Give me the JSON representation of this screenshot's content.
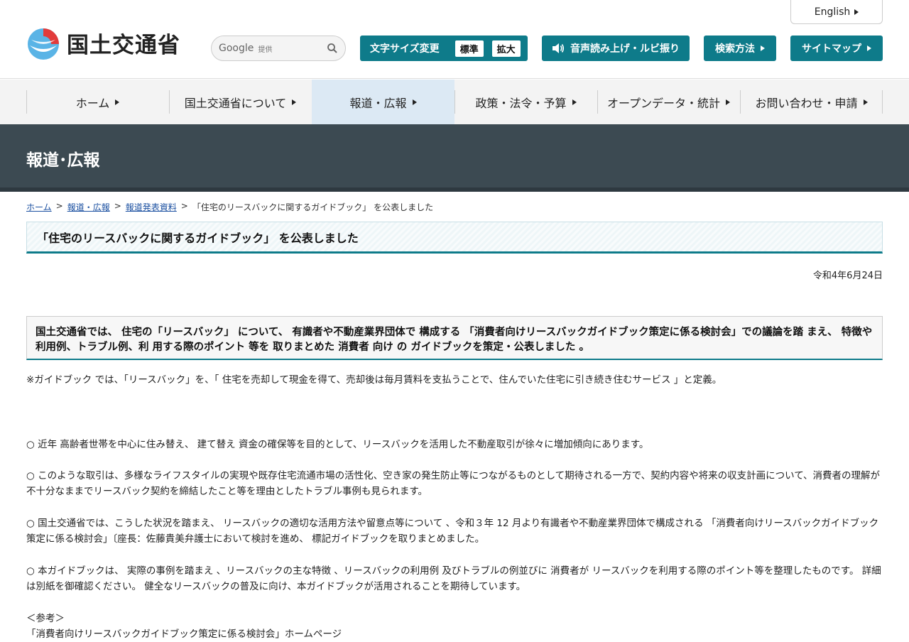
{
  "header": {
    "logo_text": "国土交通省",
    "english_label": "English",
    "search": {
      "brand": "Google",
      "provided": "提供",
      "placeholder": ""
    },
    "fontsize": {
      "label": "文字サイズ変更",
      "standard": "標準",
      "large": "拡大"
    },
    "voice_label": "音声読み上げ・ルビ振り",
    "howto_label": "検索方法",
    "sitemap_label": "サイトマップ"
  },
  "nav": {
    "items": [
      {
        "label": "ホーム"
      },
      {
        "label": "国土交通省について"
      },
      {
        "label": "報道・広報"
      },
      {
        "label": "政策・法令・予算"
      },
      {
        "label": "オープンデータ・統計"
      },
      {
        "label": "お問い合わせ・申請"
      }
    ],
    "active_index": 2
  },
  "banner": {
    "title": "報道･広報"
  },
  "breadcrumb": {
    "items": [
      "ホーム",
      "報道・広報",
      "報道発表資料"
    ],
    "separator": ">",
    "current": "「住宅のリースバックに関するガイドブック」 を公表しました"
  },
  "page": {
    "title": "「住宅のリースバックに関するガイドブック」 を公表しました",
    "date": "令和4年6月24日",
    "lead": "国土交通省では、 住宅の「リースバック」 について、 有識者や不動産業界団体で 構成する 「消費者向けリースバックガイドブック策定に係る検討会」での議論を踏 まえ、 特徴や 利用例、トラブル例、利 用する際のポイント 等を 取りまとめた 消費者 向け の ガイドブックを策定・公表しました 。",
    "note": "※ガイドブック では、「リースバック」を、「 住宅を売却して現金を得て、売却後は毎月賃料を支払うことで、住んでいた住宅に引き続き住むサービス 」と定義。",
    "bullets": [
      "○ 近年 高齢者世帯を中心に住み替え、 建て替え 資金の確保等を目的として、リースバックを活用した不動産取引が徐々に増加傾向にあります。",
      "○ このような取引は、多様なライフスタイルの実現や既存住宅流通市場の活性化、空き家の発生防止等につながるものとして期待される一方で、契約内容や将来の収支計画について、消費者の理解が不十分なままでリースバック契約を締結したこと等を理由としたトラブル事例も見られます。",
      "○ 国土交通省では、こうした状況を踏まえ、 リースバックの適切な活用方法や留意点等について 、令和３年 12 月より有識者や不動産業界団体で構成される 「消費者向けリースバックガイドブック策定に係る検討会」〔座長：佐藤貴美弁護士において検討を進め、 標記ガイドブックを取りまとめました。",
      "○ 本ガイドブックは、 実際の事例を踏まえ 、リースバックの主な特徴 、リースバックの利用例 及びトラブルの例並びに 消費者が リースバックを利用する際のポイント等を整理したものです。 詳細は別紙を御確認ください。 健全なリースバックの普及に向け、本ガイドブックが活用されることを期待しています。"
    ],
    "reference_heading": "＜参考＞",
    "reference_link": "「消費者向けリースバックガイドブック策定に係る検討会」ホームページ"
  },
  "colors": {
    "accent": "#0e7b8a",
    "banner": "#3c4a52",
    "nav_active": "#dce9f4"
  }
}
